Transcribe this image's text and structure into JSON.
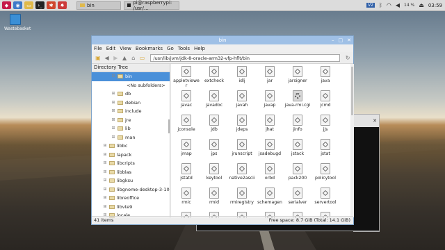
{
  "desktop": {
    "wastebasket_label": "Wastebasket"
  },
  "taskbar": {
    "tasks": [
      "bin",
      "pi@raspberrypi: /usr/..."
    ],
    "battery": "14 %",
    "clock": "03:59",
    "tray_badge": "V2"
  },
  "window": {
    "title": "bin",
    "menu": [
      "File",
      "Edit",
      "View",
      "Bookmarks",
      "Go",
      "Tools",
      "Help"
    ],
    "address": "/usr/lib/jvm/jdk-8-oracle-arm32-vfp-hflt/bin"
  },
  "sidebar": {
    "header": "Directory Tree",
    "rows": [
      {
        "label": "bin",
        "level": 2,
        "expander": "-",
        "selected": true
      },
      {
        "label": "<No subfolders>",
        "level": 3,
        "expander": "",
        "selected": false,
        "nofolder": true
      },
      {
        "label": "db",
        "level": 2,
        "expander": "+",
        "selected": false
      },
      {
        "label": "debian",
        "level": 2,
        "expander": "+",
        "selected": false
      },
      {
        "label": "include",
        "level": 2,
        "expander": "+",
        "selected": false
      },
      {
        "label": "jre",
        "level": 2,
        "expander": "+",
        "selected": false
      },
      {
        "label": "lib",
        "level": 2,
        "expander": "+",
        "selected": false
      },
      {
        "label": "man",
        "level": 2,
        "expander": "+",
        "selected": false
      },
      {
        "label": "libbc",
        "level": 1,
        "expander": "+",
        "selected": false
      },
      {
        "label": "lapack",
        "level": 1,
        "expander": "+",
        "selected": false
      },
      {
        "label": "libcripts",
        "level": 1,
        "expander": "+",
        "selected": false
      },
      {
        "label": "libblas",
        "level": 1,
        "expander": "+",
        "selected": false
      },
      {
        "label": "libgksu",
        "level": 1,
        "expander": "+",
        "selected": false
      },
      {
        "label": "libgnome-desktop-3-10",
        "level": 1,
        "expander": "+",
        "selected": false
      },
      {
        "label": "libreoffice",
        "level": 1,
        "expander": "+",
        "selected": false
      },
      {
        "label": "libvte9",
        "level": 1,
        "expander": "+",
        "selected": false
      },
      {
        "label": "locale",
        "level": 1,
        "expander": "+",
        "selected": false
      }
    ]
  },
  "files": [
    "appletviewer",
    "extcheck",
    "idlj",
    "jar",
    "jarsigner",
    "java",
    "javac",
    "javadoc",
    "javah",
    "javap",
    "java-rmi.cgi",
    "jcmd",
    "jconsole",
    "jdb",
    "jdeps",
    "jhat",
    "jinfo",
    "jjs",
    "jmap",
    "jps",
    "jrunscript",
    "jsadebugd",
    "jstack",
    "jstat",
    "jstatd",
    "keytool",
    "native2ascii",
    "orbd",
    "pack200",
    "policytool",
    "rmic",
    "rmid",
    "rmiregistry",
    "schemagen",
    "serialver",
    "servertool",
    "",
    "",
    "",
    "",
    "",
    ""
  ],
  "gear_file": "java-rmi.cgi",
  "status": {
    "left": "41 items",
    "right": "Free space: 8.7 GiB (Total: 14.1 GiB)"
  }
}
